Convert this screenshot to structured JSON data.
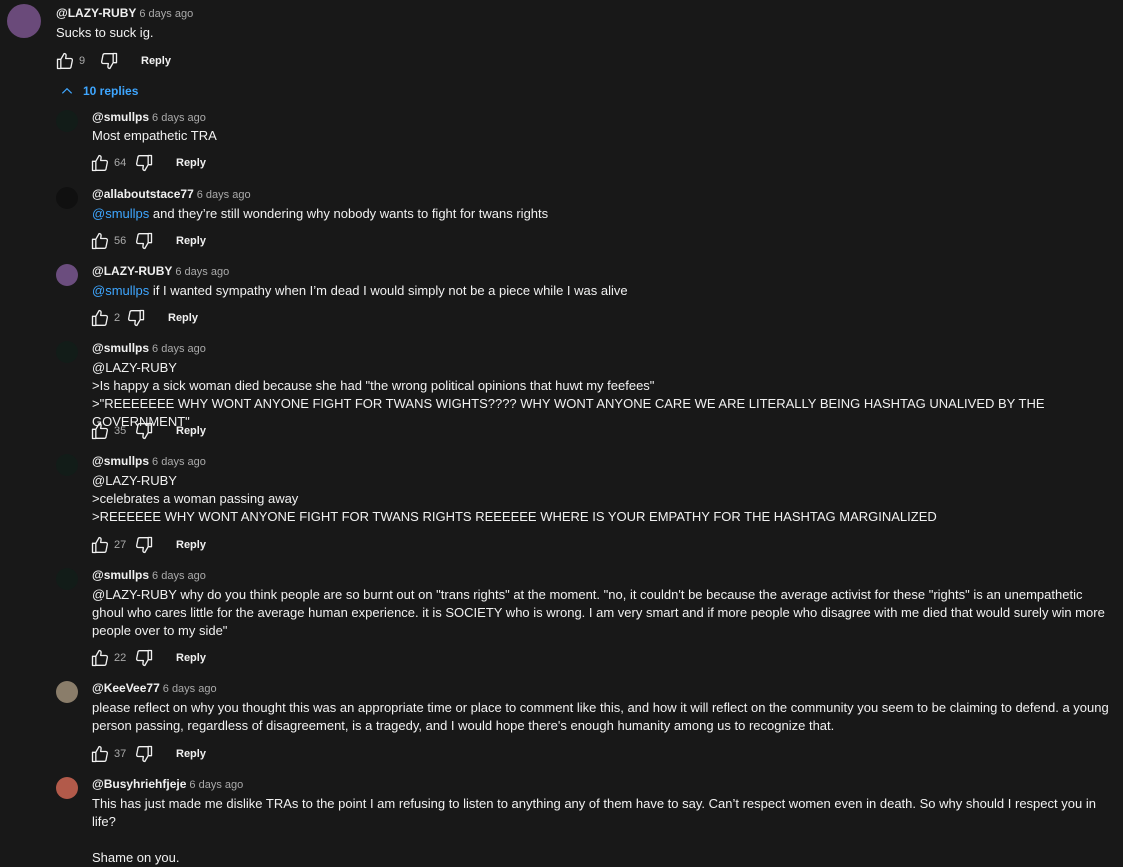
{
  "top_comment": {
    "author": "@LAZY-RUBY",
    "time": "6 days ago",
    "text": "Sucks to suck ig.",
    "likes": "9",
    "reply_label": "Reply"
  },
  "replies_toggle": {
    "label": "10 replies"
  },
  "replies": [
    {
      "author": "@smullps",
      "time": "6 days ago",
      "mention": "",
      "text": "Most empathetic TRA",
      "likes": "64",
      "reply_label": "Reply"
    },
    {
      "author": "@allaboutstace77",
      "time": "6 days ago",
      "mention": "@smullps",
      "text": " and they’re still wondering why nobody wants to fight for twans rights",
      "likes": "56",
      "reply_label": "Reply"
    },
    {
      "author": "@LAZY-RUBY",
      "time": "6 days ago",
      "mention": "@smullps",
      "text": "  if I wanted sympathy when I’m dead I would simply not be a piece while I was alive",
      "likes": "2",
      "reply_label": "Reply"
    },
    {
      "author": "@smullps",
      "time": "6 days ago",
      "mention": "",
      "text": "@LAZY-RUBY\n>Is happy a sick woman died because she had \"the wrong political opinions that huwt my feefees\"\n>\"REEEEEEE WHY WONT ANYONE FIGHT FOR TWANS WIGHTS???? WHY WONT ANYONE CARE WE ARE LITERALLY BEING HASHTAG UNALIVED BY THE GOVERNMENT\"",
      "likes": "35",
      "reply_label": "Reply"
    },
    {
      "author": "@smullps",
      "time": "6 days ago",
      "mention": "",
      "text": "@LAZY-RUBY\n>celebrates a woman passing away\n>REEEEEE WHY WONT ANYONE FIGHT FOR TWANS RIGHTS REEEEEE WHERE IS YOUR EMPATHY FOR THE HASHTAG MARGINALIZED",
      "likes": "27",
      "reply_label": "Reply"
    },
    {
      "author": "@smullps",
      "time": "6 days ago",
      "mention": "",
      "text": "@LAZY-RUBY   why do you think people are so burnt out on \"trans rights\" at the moment. \"no, it couldn't be because the average activist for these \"rights\" is an unempathetic ghoul who cares little for the average human experience. it is SOCIETY who is wrong. I am very smart and if more people who disagree with me died that would surely win more people over to my side\"",
      "likes": "22",
      "reply_label": "Reply"
    },
    {
      "author": "@KeeVee77",
      "time": "6 days ago",
      "mention": "",
      "text": "please reflect on why you thought this was an appropriate time or place to comment like this, and how it will reflect on the community you seem to be claiming to defend. a young person passing, regardless of disagreement, is a tragedy, and I would hope there's enough humanity among us to recognize that.",
      "likes": "37",
      "reply_label": "Reply"
    },
    {
      "author": "@Busyhriehfjeje",
      "time": "6 days ago",
      "mention": "",
      "text": "This has just made me dislike TRAs to the point I am refusing to listen to anything any of them have to say. Can’t respect women even in death. So why should I respect you in life?\n\nShame on you.",
      "likes": "",
      "reply_label": ""
    }
  ],
  "icons": [
    "like-icon",
    "dislike-icon",
    "chevron-up-icon"
  ],
  "colors": {
    "background": "#181818",
    "text": "#f1f1f1",
    "secondary": "#aaaaaa",
    "link": "#3ea6ff"
  }
}
